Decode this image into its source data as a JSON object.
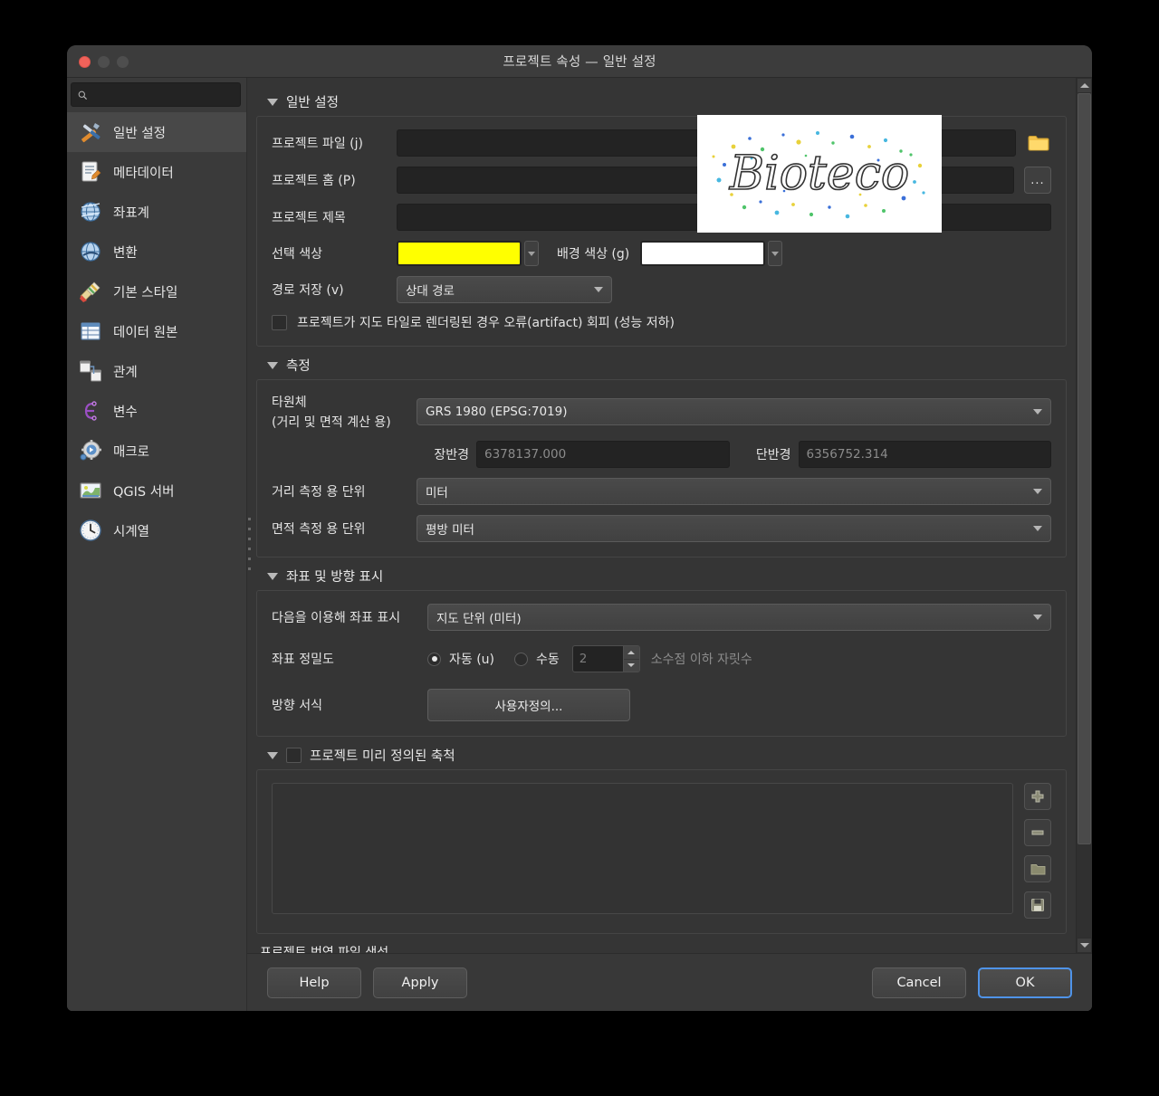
{
  "window": {
    "title": "프로젝트 속성 — 일반 설정",
    "traffic": {
      "close": "close-button",
      "minimize": "minimize-button",
      "maximize": "maximize-button"
    }
  },
  "sidebar": {
    "search_placeholder": "",
    "search_value": "",
    "items": [
      {
        "label": "일반 설정",
        "icon": "tools-icon",
        "active": true
      },
      {
        "label": "메타데이터",
        "icon": "metadata-icon",
        "active": false
      },
      {
        "label": "좌표계",
        "icon": "globe-grid-icon",
        "active": false
      },
      {
        "label": "변환",
        "icon": "globe-arrow-icon",
        "active": false
      },
      {
        "label": "기본 스타일",
        "icon": "brush-icon",
        "active": false
      },
      {
        "label": "데이터 원본",
        "icon": "table-icon",
        "active": false
      },
      {
        "label": "관계",
        "icon": "relations-icon",
        "active": false
      },
      {
        "label": "변수",
        "icon": "variables-icon",
        "active": false
      },
      {
        "label": "매크로",
        "icon": "macro-gear-icon",
        "active": false
      },
      {
        "label": "QGIS 서버",
        "icon": "server-map-icon",
        "active": false
      },
      {
        "label": "시계열",
        "icon": "clock-icon",
        "active": false
      }
    ]
  },
  "general": {
    "title": "일반 설정",
    "project_file": {
      "label": "프로젝트 파일 (j)",
      "value": "",
      "button": "folder-icon"
    },
    "project_home": {
      "label": "프로젝트 홈 (P)",
      "value": "",
      "button": "..."
    },
    "project_title": {
      "label": "프로젝트 제목",
      "value": ""
    },
    "selection_color": {
      "label": "선택 색상",
      "value": "#FFFF00"
    },
    "background_color": {
      "label": "배경 색상 (g)",
      "value": "#FFFFFF"
    },
    "save_paths": {
      "label": "경로 저장 (v)",
      "value": "상대 경로"
    },
    "avoid_artifacts": {
      "label": "프로젝트가 지도 타일로 렌더링된 경우 오류(artifact) 회피 (성능 저하)",
      "checked": false
    }
  },
  "measurement": {
    "title": "측정",
    "ellipsoid": {
      "label_line1": "타원체",
      "label_line2": "(거리 및 면적 계산 용)",
      "value": "GRS 1980 (EPSG:7019)"
    },
    "semi_major": {
      "label": "장반경",
      "value": "6378137.000"
    },
    "semi_minor": {
      "label": "단반경",
      "value": "6356752.314"
    },
    "distance_units": {
      "label": "거리 측정 용 단위",
      "value": "미터"
    },
    "area_units": {
      "label": "면적 측정 용 단위",
      "value": "평방 미터"
    }
  },
  "coordinate": {
    "title": "좌표 및 방향 표시",
    "display_using": {
      "label": "다음을 이용해 좌표 표시",
      "value": "지도 단위 (미터)"
    },
    "precision": {
      "label": "좌표 정밀도",
      "auto": {
        "label": "자동 (u)",
        "selected": true
      },
      "manual": {
        "label": "수동",
        "selected": false
      },
      "decimal_places": "2",
      "decimal_label": "소수점 이하 자릿수"
    },
    "bearing_format": {
      "label": "방향 서식",
      "button": "사용자정의..."
    }
  },
  "scales": {
    "title": "프로젝트 미리 정의된 축척",
    "checked": false,
    "items": [],
    "tools": [
      {
        "name": "add-scale-button",
        "icon": "plus-icon"
      },
      {
        "name": "remove-scale-button",
        "icon": "minus-icon"
      },
      {
        "name": "open-scales-button",
        "icon": "folder-icon"
      },
      {
        "name": "save-scales-button",
        "icon": "save-icon"
      }
    ]
  },
  "translation": {
    "title": "프로젝트 번역 파일 생성"
  },
  "overlay_logo": {
    "name": "bioteco-logo",
    "text": "Bioteco"
  },
  "footer": {
    "help": "Help",
    "apply": "Apply",
    "cancel": "Cancel",
    "ok": "OK"
  },
  "colors": {
    "accent": "#4f93e8",
    "selection": "#FFFF00",
    "background": "#FFFFFF",
    "folder": "#f2c14a"
  }
}
